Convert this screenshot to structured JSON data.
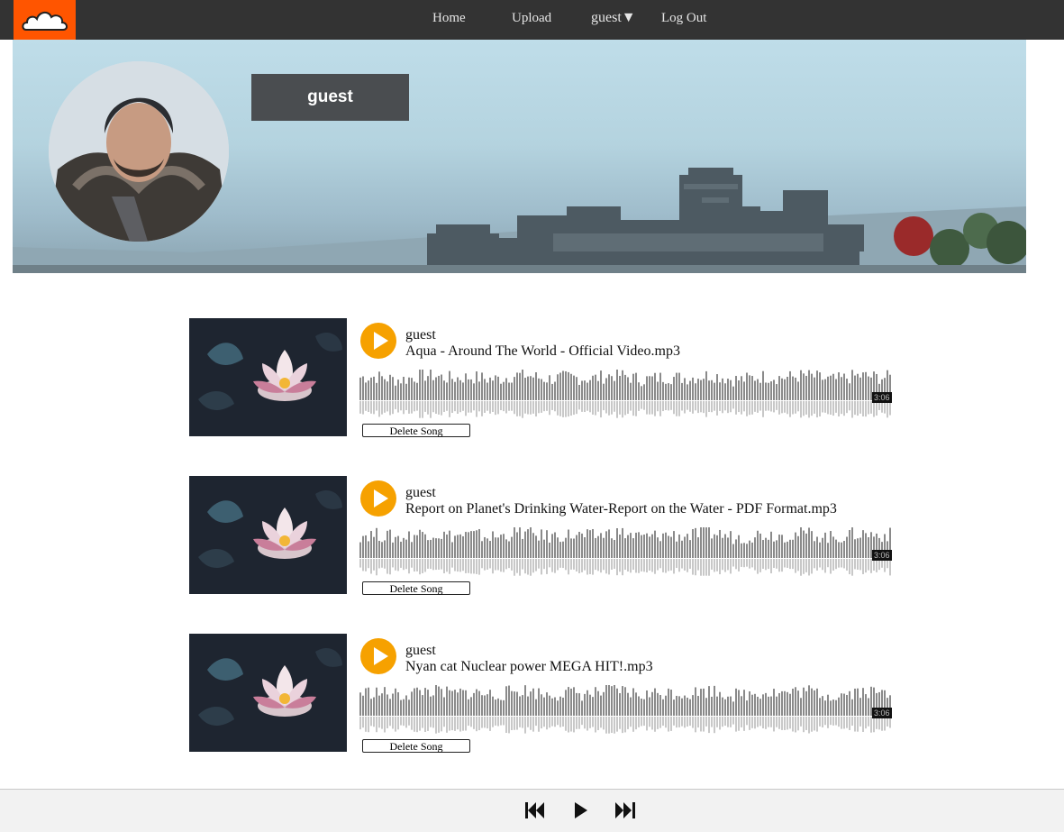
{
  "nav": {
    "links": [
      "Home",
      "Upload"
    ],
    "user_menu": "guest▼",
    "logout": "Log Out"
  },
  "profile": {
    "username": "guest"
  },
  "songs": [
    {
      "user": "guest",
      "title": "Aqua - Around The World - Official Video.mp3",
      "duration": "3:06",
      "delete_label": "Delete Song"
    },
    {
      "user": "guest",
      "title": "Report on Planet's Drinking Water-Report on the Water - PDF Format.mp3",
      "duration": "3:06",
      "delete_label": "Delete Song"
    },
    {
      "user": "guest",
      "title": "Nyan cat Nuclear power MEGA HIT!.mp3",
      "duration": "3:06",
      "delete_label": "Delete Song"
    }
  ],
  "player": {
    "controls": [
      "previous-icon",
      "play-icon",
      "next-icon"
    ]
  },
  "colors": {
    "nav_bg": "#333333",
    "logo_bg": "#ff5500",
    "play_button": "#f6a100",
    "username_box": "#4a4d50",
    "player_bg": "#f2f2f2"
  }
}
